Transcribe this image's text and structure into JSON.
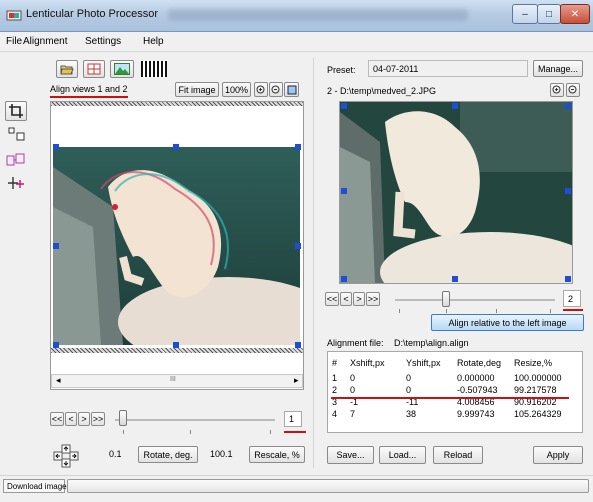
{
  "window": {
    "title": "Lenticular Photo Processor",
    "controls": {
      "minimize": "–",
      "maximize": "□",
      "close": "✕"
    }
  },
  "menu": [
    {
      "label": "File"
    },
    {
      "label": "Alignment"
    },
    {
      "label": "Settings"
    },
    {
      "label": "Help"
    }
  ],
  "left_panel": {
    "align_label": "Align views 1 and 2",
    "fit_image_label": "Fit image",
    "zoom_value": "100%",
    "tool_icons": [
      "crop-icon",
      "resize-frame-icon",
      "shift-frames-icon",
      "crosshair-icon"
    ],
    "nav_buttons": [
      "<<",
      "<",
      ">",
      ">>"
    ],
    "frame_index": "1",
    "scroll_left": "◂",
    "scroll_right": "▸",
    "scroll_thumb": "III"
  },
  "bottom_left": {
    "rotate_value": "0.1",
    "rotate_label": "Rotate, deg.",
    "rescale_value": "100.1",
    "rescale_label": "Rescale, %"
  },
  "right_panel": {
    "preset_label": "Preset:",
    "preset_value": "04-07-2011",
    "manage_label": "Manage...",
    "image_path": "2 - D:\\temp\\medved_2.JPG",
    "nav_buttons": [
      "<<",
      "<",
      ">",
      ">>"
    ],
    "frame_index": "2",
    "align_relative_label": "Align relative to the left image",
    "alignment_file_label": "Alignment file:",
    "alignment_file_value": "D:\\temp\\align.align"
  },
  "alignment_table": {
    "columns": [
      "#",
      "Xshift,px",
      "Yshift,px",
      "Rotate,deg",
      "Resize,%"
    ],
    "rows": [
      [
        "1",
        "0",
        "0",
        "0.000000",
        "100.000000"
      ],
      [
        "2",
        "0",
        "0",
        "-0.507943",
        "99.217578"
      ],
      [
        "3",
        "-1",
        "-11",
        "4.008456",
        "90.916202"
      ],
      [
        "4",
        "7",
        "38",
        "9.999743",
        "105.264329"
      ]
    ]
  },
  "bottom_right": {
    "save_label": "Save...",
    "load_label": "Load...",
    "reload_label": "Reload",
    "apply_label": "Apply"
  },
  "status": {
    "download_label": "Download images"
  },
  "colors": {
    "accent_red": "#cc1010",
    "handle_blue": "#1d4fd6",
    "titlebar": "#b6cbe3"
  }
}
